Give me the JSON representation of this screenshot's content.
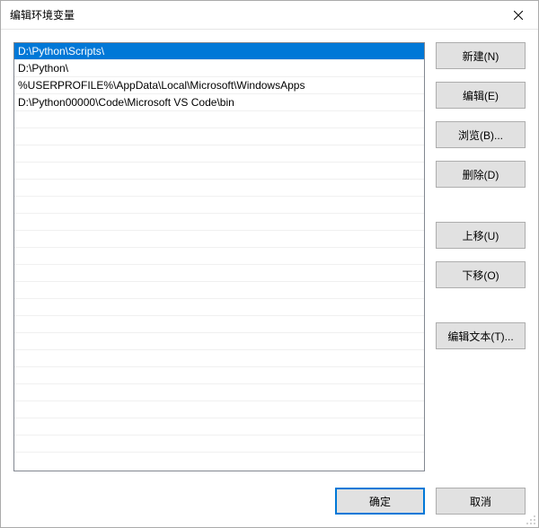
{
  "window": {
    "title": "编辑环境变量"
  },
  "list": {
    "items": [
      {
        "value": "D:\\Python\\Scripts\\",
        "selected": true
      },
      {
        "value": "D:\\Python\\",
        "selected": false
      },
      {
        "value": "%USERPROFILE%\\AppData\\Local\\Microsoft\\WindowsApps",
        "selected": false
      },
      {
        "value": "D:\\Python00000\\Code\\Microsoft VS Code\\bin",
        "selected": false
      }
    ],
    "visible_rows": 24
  },
  "buttons": {
    "new": "新建(N)",
    "edit": "编辑(E)",
    "browse": "浏览(B)...",
    "delete": "删除(D)",
    "move_up": "上移(U)",
    "move_down": "下移(O)",
    "edit_text": "编辑文本(T)...",
    "ok": "确定",
    "cancel": "取消"
  }
}
